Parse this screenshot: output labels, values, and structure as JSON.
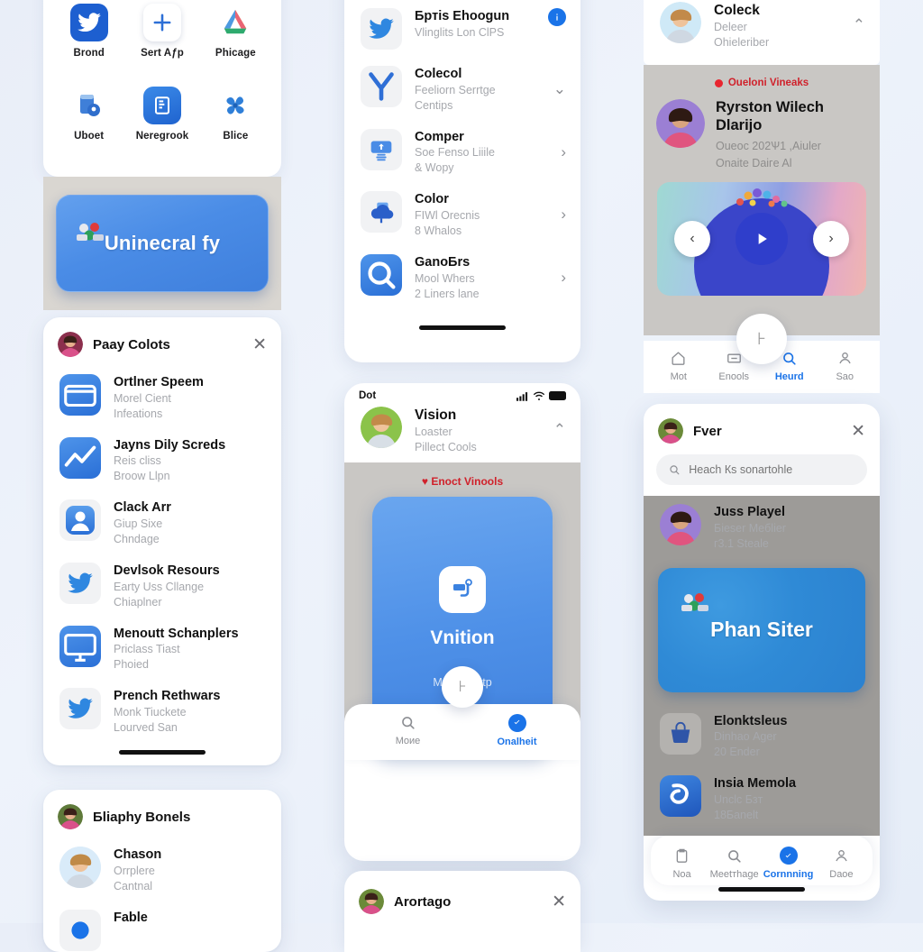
{
  "theme": {
    "accent": "#1a73e8",
    "live_red": "#d0212b",
    "banner_blue": "#4a8ce6",
    "muted": "#a6a8ad"
  },
  "left": {
    "app_grid": [
      {
        "label": "Brond",
        "icon": "twitter-bird-icon"
      },
      {
        "label": "Sert Aƒp",
        "icon": "plus-icon"
      },
      {
        "label": "Phicage",
        "icon": "photos-icon"
      },
      {
        "label": "Uboet",
        "icon": "location-book-icon"
      },
      {
        "label": "Neregrook",
        "icon": "news-icon"
      },
      {
        "label": "Blice",
        "icon": "pinwheel-icon"
      }
    ],
    "banner": {
      "title": "Uninecral fy",
      "badge_icon": "group-people-icon"
    },
    "list_card": {
      "header_title": "Paay Colots",
      "close_label": "✕",
      "items": [
        {
          "title": "Ortlner Speem",
          "line1": "Morеl Cient",
          "line2": "Infeations",
          "icon": "folder-icon"
        },
        {
          "title": "Jaуns Dily Screds",
          "line1": "Reis cliss",
          "line2": "Broow Llpn",
          "icon": "chart-line-icon"
        },
        {
          "title": "Clack Arr",
          "line1": "Giup Sixe",
          "line2": "Chndage",
          "icon": "person-icon"
        },
        {
          "title": "Devlsok Resours",
          "line1": "Earty Uss Cllange",
          "line2": "Chiaplner",
          "icon": "twitter-bird-icon"
        },
        {
          "title": "Menoutt Schanplers",
          "line1": "Priclass Tiast",
          "line2": "Phоied",
          "icon": "monitor-icon"
        },
        {
          "title": "Prench Rethwars",
          "line1": "Monk Tiuckete",
          "line2": "Lourved San",
          "icon": "twitter-bird-icon"
        }
      ]
    },
    "bottom_card": {
      "header_title": "Бliaphy Bonels",
      "items": [
        {
          "title": "Chason",
          "line1": "Orrplere",
          "line2": "Cantnal",
          "icon": "avatar-photo-icon"
        },
        {
          "title": "Fаble",
          "line1": "",
          "line2": "",
          "icon": "blue-dot-icon"
        }
      ]
    }
  },
  "middle": {
    "top_list": [
      {
        "title": "Бртis Ehoogun",
        "line1": "Vlinglits Lon ClPS",
        "line2": "",
        "icon": "twitter-bird-icon",
        "trailing": "info-badge"
      },
      {
        "title": "Colecol",
        "line1": "Feeliorn Serrtge",
        "line2": "Centips",
        "icon": "y-logo-icon",
        "trailing": "chevron-down-icon"
      },
      {
        "title": "Comper",
        "line1": "Soe Fenso Liiile",
        "line2": "& Wopy",
        "icon": "printer-icon",
        "trailing": "chevron-right-icon"
      },
      {
        "title": "Color",
        "line1": "FIWl Orecnis",
        "line2": "8 Whalos",
        "icon": "cloud-icon",
        "trailing": "chevron-right-icon"
      },
      {
        "title": "GanoБrs",
        "line1": "Mool Whers",
        "line2": "2 Liners lane",
        "icon": "search-app-icon",
        "trailing": "chevron-right-icon"
      }
    ],
    "phone": {
      "status_bar": {
        "carrier": "Dot",
        "signal_icon": "cellular-icon",
        "wifi_icon": "wifi-icon",
        "battery_icon": "battery-icon"
      },
      "header": {
        "title": "Vision",
        "line1": "Loaster",
        "line2": "Pillect Cools",
        "collapse_icon": "chevron-up-icon"
      },
      "enact_label": "Enoct Vinools",
      "hero": {
        "title": "Vnition",
        "subtitle": "Menoolohtp",
        "icon": "card-app-icon"
      },
      "tabs": [
        {
          "label": "Moиe",
          "icon": "search-icon",
          "active": false
        },
        {
          "label": "Onalheit",
          "icon": "verified-badge-icon",
          "active": true
        }
      ],
      "fab_icon": "flag-icon"
    },
    "bottom_card": {
      "header_title": "Arortago",
      "close_label": "✕"
    }
  },
  "right": {
    "header": {
      "title": "Coleck",
      "line1": "Deleer",
      "line2": "Ohieleriber",
      "collapse_icon": "chevron-up-icon"
    },
    "live_label": "Oueloni Vineaks",
    "feature": {
      "title": "Ryrston Wilech Dlariјo",
      "line1": "Oueoс 202Ѱ1 ,Aiuler",
      "line2": "Onаite Daiгe Al"
    },
    "player": {
      "prev_icon": "chevron-left-icon",
      "play_icon": "play-icon",
      "next_icon": "chevron-right-icon"
    },
    "tabs": [
      {
        "label": "Mot",
        "icon": "home-icon",
        "active": false
      },
      {
        "label": "Enools",
        "icon": "ticket-icon",
        "active": false
      },
      {
        "label": "Heurd",
        "icon": "search-icon",
        "active": true
      },
      {
        "label": "Saо",
        "icon": "person-icon",
        "active": false
      }
    ],
    "fab_icon": "flag-icon",
    "card": {
      "header_title": "Fver",
      "close_label": "✕",
      "search_placeholder": "Heach Кs sonartohle",
      "highlight": {
        "title": "Juss Playel",
        "line1": "Бieser Meбlier",
        "line2": "г3.1 Steale"
      },
      "banner": {
        "title": "Phan Siter",
        "badge_icon": "group-people-icon"
      },
      "items": [
        {
          "title": "Elonktsleus",
          "line1": "Dinhao Аger",
          "line2": "20 Ender",
          "icon": "basket-icon"
        },
        {
          "title": "Insia Memola",
          "line1": "Unclc Бзт",
          "line2": "18Бanelt",
          "icon": "swirl-icon"
        }
      ],
      "tabs": [
        {
          "label": "Noа",
          "icon": "clipboard-icon",
          "active": false
        },
        {
          "label": "Meetтhage",
          "icon": "search-icon",
          "active": false
        },
        {
          "label": "Cornnning",
          "icon": "verified-badge-icon",
          "active": true
        },
        {
          "label": "Daоe",
          "icon": "person-icon",
          "active": false
        }
      ]
    }
  }
}
